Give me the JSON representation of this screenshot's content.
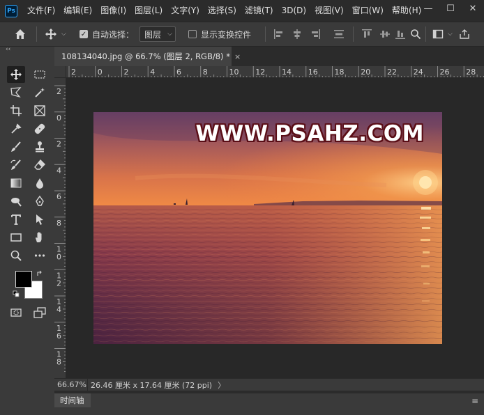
{
  "app": {
    "logo_text": "Ps"
  },
  "menu": [
    "文件(F)",
    "编辑(E)",
    "图像(I)",
    "图层(L)",
    "文字(Y)",
    "选择(S)",
    "滤镜(T)",
    "3D(D)",
    "视图(V)",
    "窗口(W)",
    "帮助(H)"
  ],
  "window_controls": {
    "minimize": "—",
    "maximize": "☐",
    "close": "✕"
  },
  "options": {
    "auto_select_label": "自动选择：",
    "auto_select_checked": true,
    "layer_select_value": "图层",
    "show_transform_label": "显示变换控件",
    "show_transform_checked": false
  },
  "collapse_glyph": "‹‹",
  "document": {
    "tab_title": "108134040.jpg @ 66.7% (图层 2, RGB/8) *",
    "close_glyph": "×",
    "watermark": "WWW.PSAHZ.COM"
  },
  "ruler": {
    "horizontal": [
      "2",
      "0",
      "2",
      "4",
      "6",
      "8",
      "10",
      "12",
      "14",
      "16",
      "18",
      "20",
      "22",
      "24",
      "26",
      "28"
    ],
    "vertical": [
      "2",
      "0",
      "2",
      "4",
      "6",
      "8",
      "1 0",
      "1 2",
      "1 4",
      "1 6",
      "1 8"
    ]
  },
  "status": {
    "zoom": "66.67%",
    "doc_info": "26.46 厘米 x 17.64 厘米 (72 ppi)",
    "arrow": "〉"
  },
  "timeline": {
    "tab_label": "时间轴",
    "menu_glyph": "≡"
  },
  "colors": {
    "foreground": "#000000",
    "background": "#ffffff",
    "accent": "#31a8ff"
  }
}
